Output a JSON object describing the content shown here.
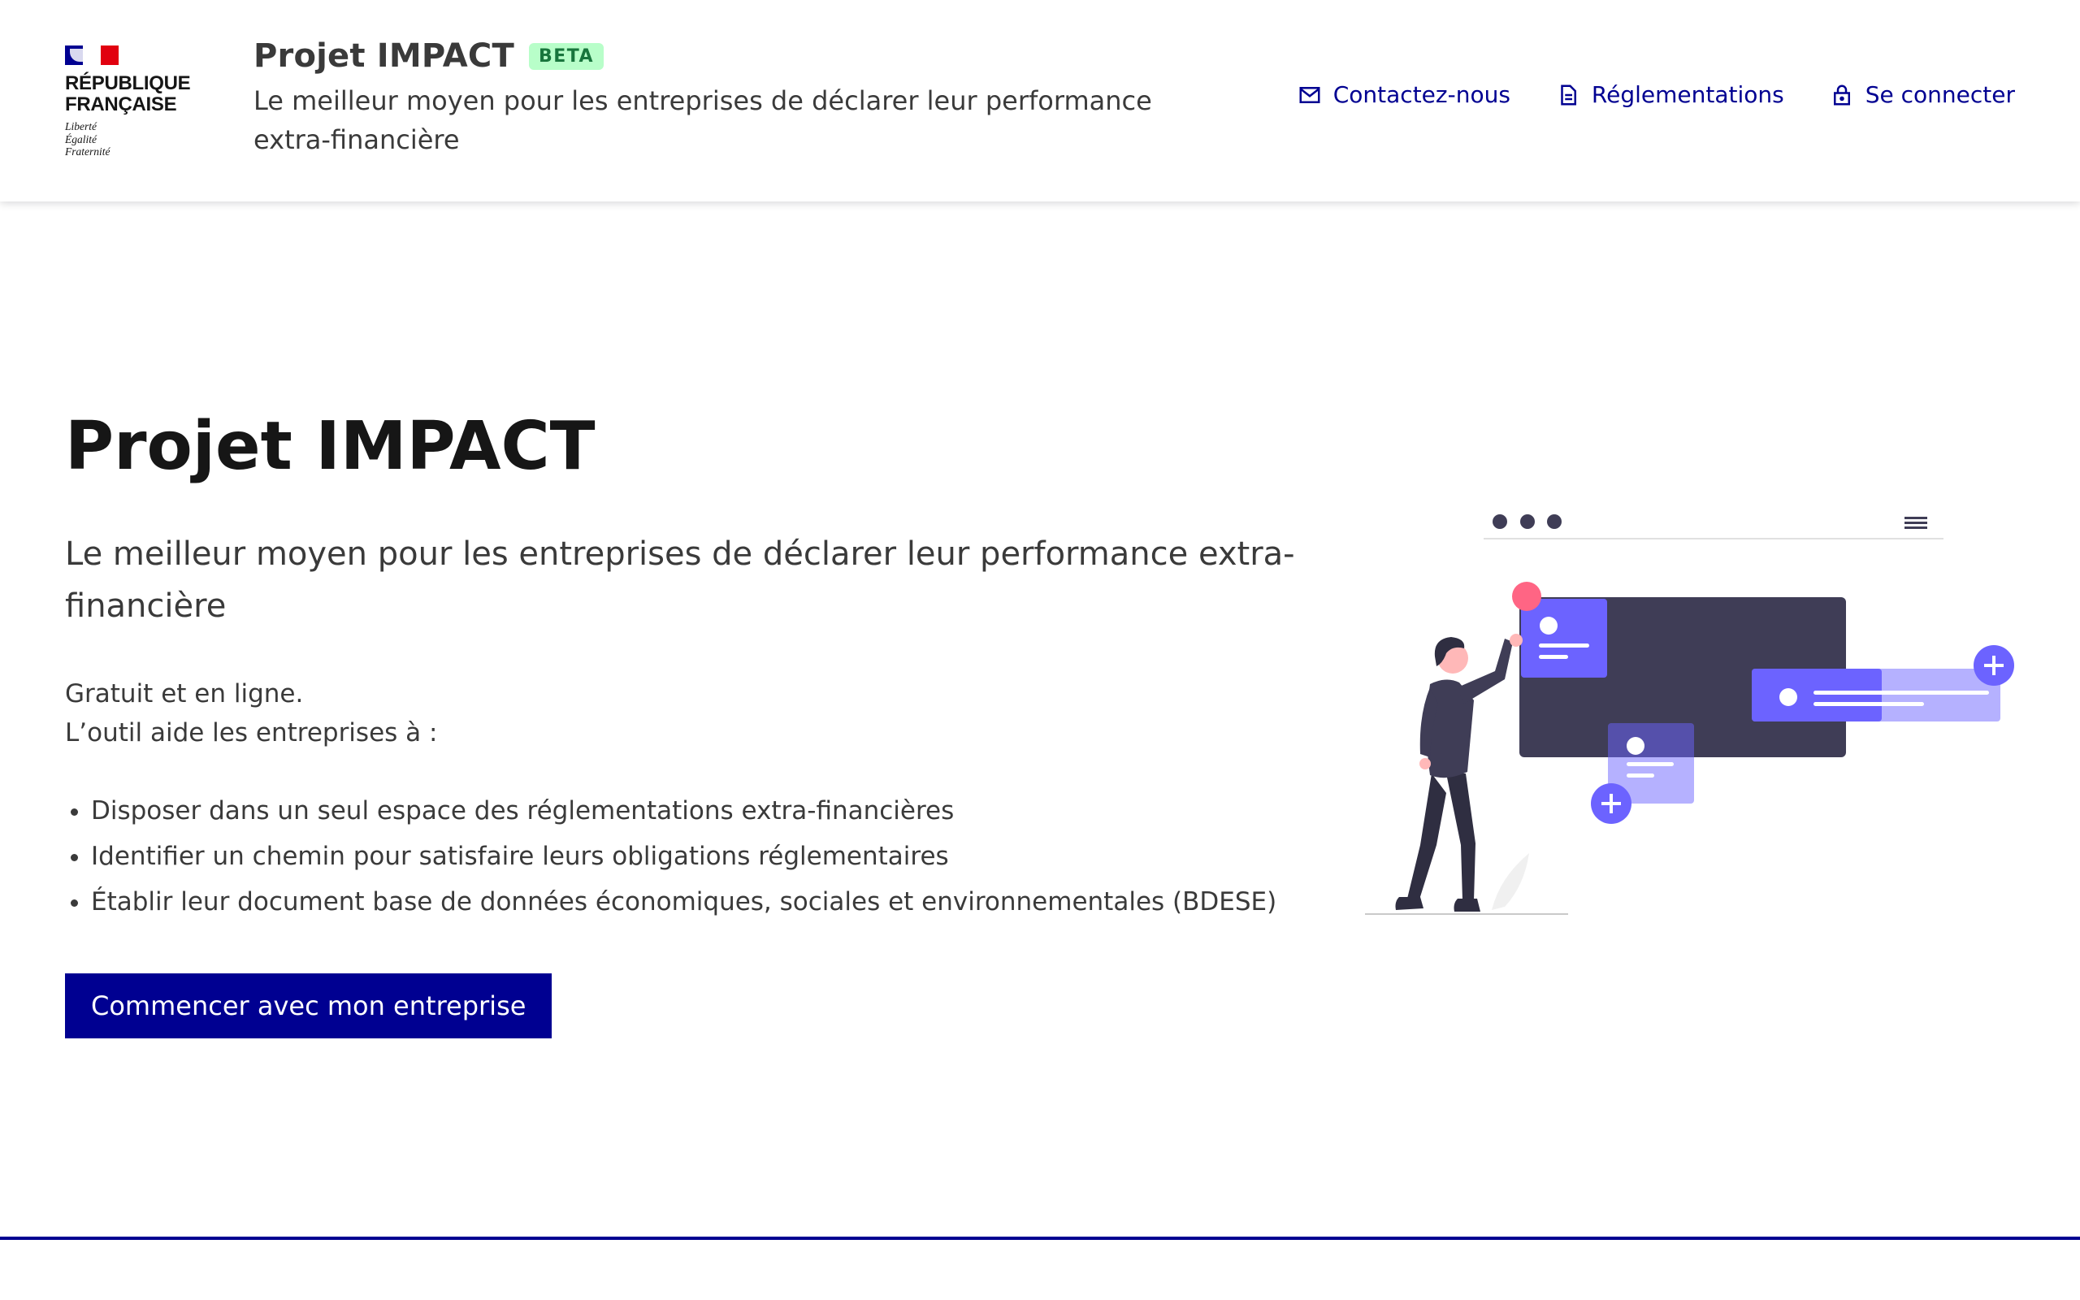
{
  "header": {
    "republique": {
      "title_line1": "RÉPUBLIQUE",
      "title_line2": "FRANÇAISE",
      "motto_line1": "Liberté",
      "motto_line2": "Égalité",
      "motto_line3": "Fraternité"
    },
    "service_title": "Projet IMPACT",
    "badge": "BETA",
    "service_tagline": "Le meilleur moyen pour les entreprises de déclarer leur performance extra-financière",
    "quick_links": [
      {
        "label": "Contactez-nous",
        "icon": "mail-icon"
      },
      {
        "label": "Réglementations",
        "icon": "document-icon"
      },
      {
        "label": "Se connecter",
        "icon": "lock-icon"
      }
    ]
  },
  "hero": {
    "title": "Projet IMPACT",
    "lead": "Le meilleur moyen pour les entreprises de déclarer leur performance extra-financière",
    "intro_line1": "Gratuit et en ligne.",
    "intro_line2": "L’outil aide les entreprises à :",
    "items": [
      "Disposer dans un seul espace des réglementations extra-financières",
      "Identifier un chemin pour satisfaire leurs obligations réglementaires",
      "Établir leur document base de données économiques, sociales et environnementales (BDESE)"
    ],
    "cta_label": "Commencer avec mon entreprise"
  },
  "colors": {
    "primary": "#000091",
    "badge_bg": "#b8fec9",
    "badge_text": "#18753c",
    "illustration_accent": "#6c63ff",
    "illustration_dark": "#3f3d56",
    "illustration_pink": "#ff6584"
  }
}
